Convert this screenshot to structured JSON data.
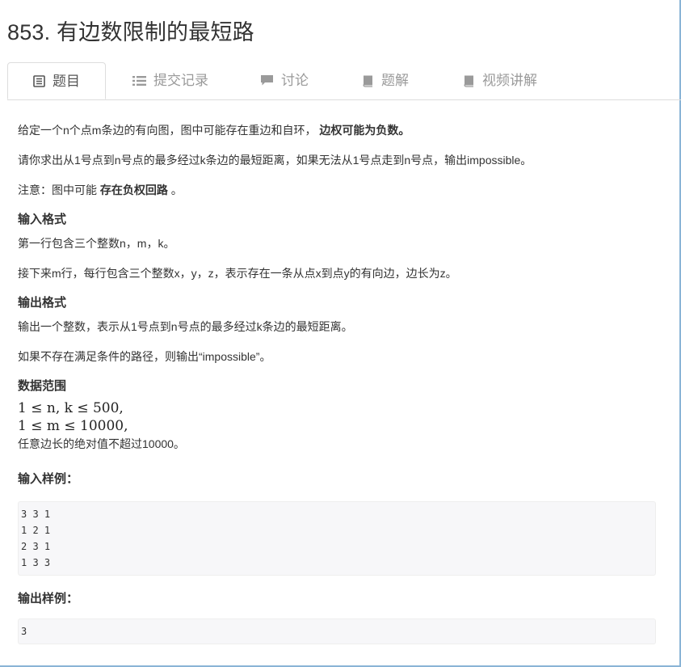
{
  "problem": {
    "title": "853. 有边数限制的最短路"
  },
  "tabs": [
    {
      "label": "题目",
      "icon": "document-icon",
      "active": true
    },
    {
      "label": "提交记录",
      "icon": "list-icon",
      "active": false
    },
    {
      "label": "讨论",
      "icon": "comment-icon",
      "active": false
    },
    {
      "label": "题解",
      "icon": "book-icon",
      "active": false
    },
    {
      "label": "视频讲解",
      "icon": "book-icon",
      "active": false
    }
  ],
  "description": {
    "p1_text": "给定一个n个点m条边的有向图，图中可能存在重边和自环，",
    "p1_bold": "边权可能为负数。",
    "p2": "请你求出从1号点到n号点的最多经过k条边的最短距离，如果无法从1号点走到n号点，输出impossible。",
    "p3_text": "注意：图中可能",
    "p3_bold": "存在负权回路",
    "p3_end": "。"
  },
  "input_format": {
    "heading": "输入格式",
    "line1": "第一行包含三个整数n，m，k。",
    "line2": "接下来m行，每行包含三个整数x，y，z，表示存在一条从点x到点y的有向边，边长为z。"
  },
  "output_format": {
    "heading": "输出格式",
    "line1": "输出一个整数，表示从1号点到n号点的最多经过k条边的最短距离。",
    "line2": "如果不存在满足条件的路径，则输出“impossible”。"
  },
  "data_range": {
    "heading": "数据范围",
    "math1": "1 ≤ n, k ≤ 500,",
    "math2": "1 ≤ m ≤ 10000,",
    "line3": "任意边长的绝对值不超过10000。"
  },
  "sample_input": {
    "heading": "输入样例：",
    "text": "3 3 1\n1 2 1\n2 3 1\n1 3 3"
  },
  "sample_output": {
    "heading": "输出样例：",
    "text": "3"
  }
}
